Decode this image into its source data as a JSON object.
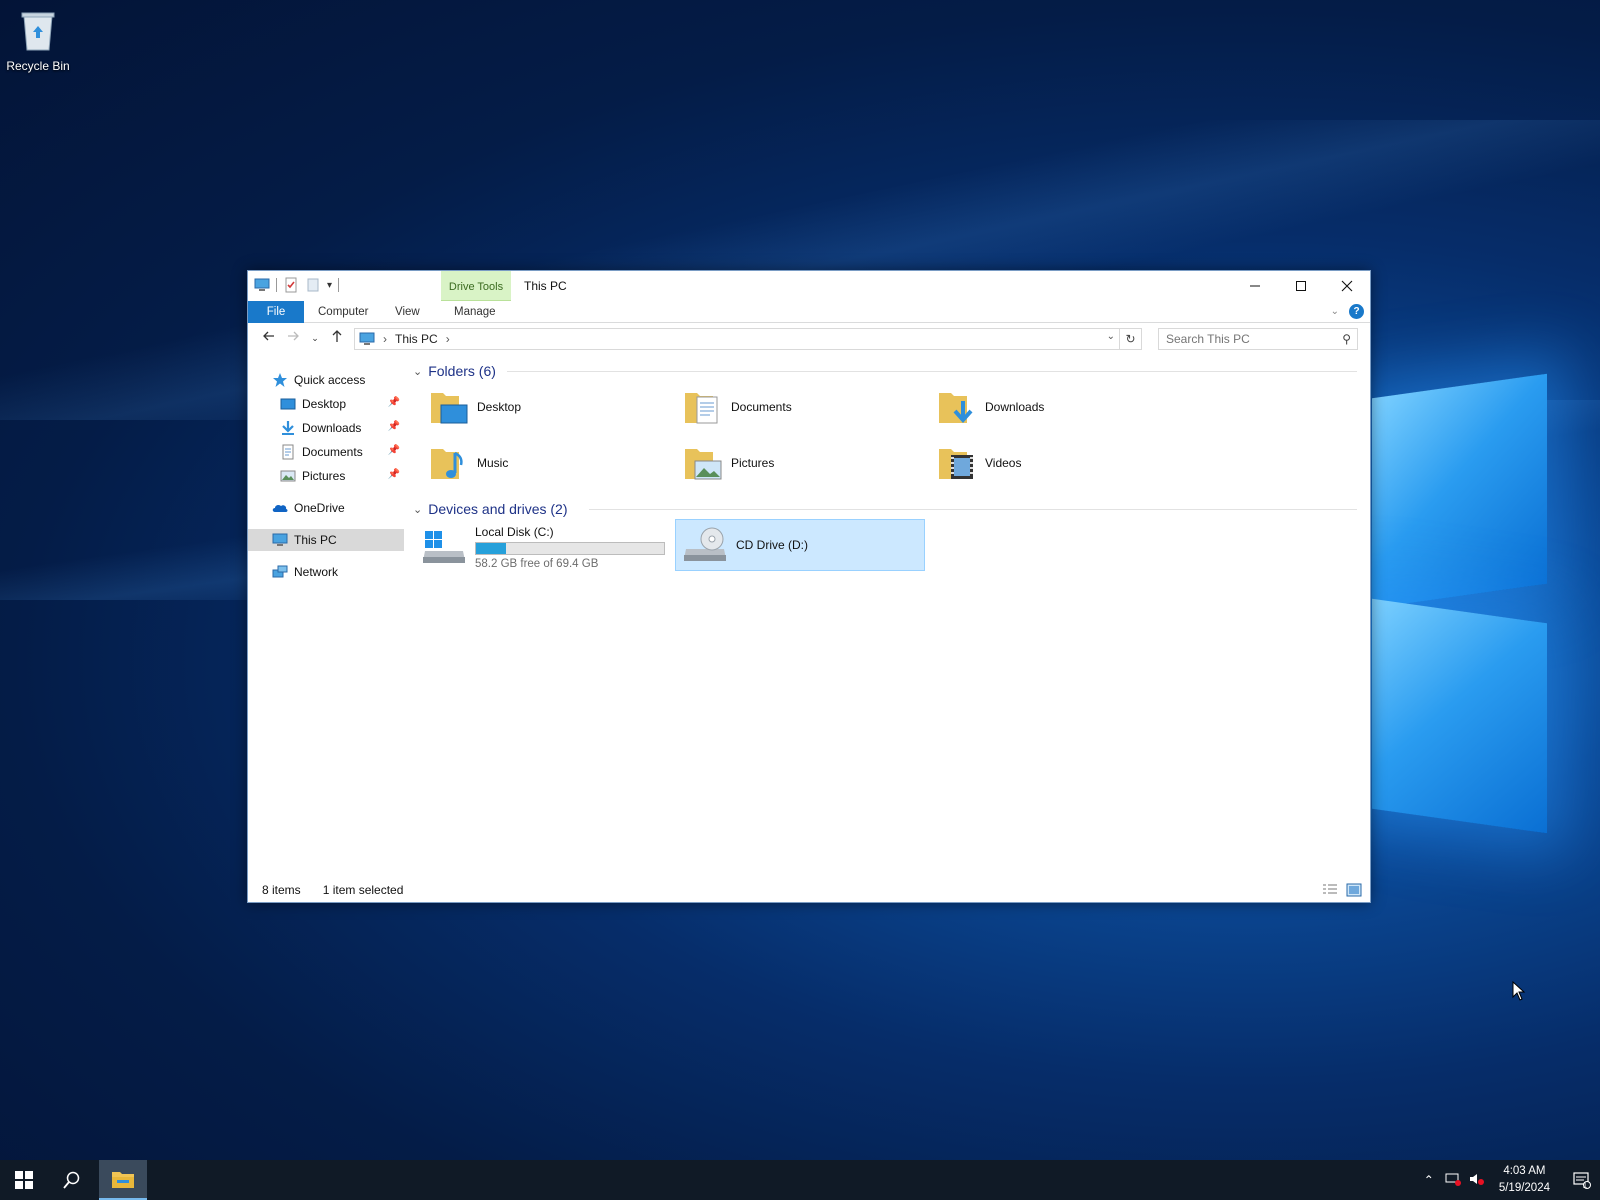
{
  "desktop": {
    "recycle_bin_label": "Recycle Bin"
  },
  "window": {
    "title": "This PC",
    "context_tab_group": "Drive Tools",
    "ribbon_tabs": {
      "file": "File",
      "computer": "Computer",
      "view": "View",
      "manage": "Manage"
    },
    "help_glyph": "?",
    "address": {
      "crumb": "This PC"
    },
    "search": {
      "placeholder": "Search This PC"
    },
    "nav": {
      "quick_access": "Quick access",
      "desktop": "Desktop",
      "downloads": "Downloads",
      "documents": "Documents",
      "pictures": "Pictures",
      "onedrive": "OneDrive",
      "this_pc": "This PC",
      "network": "Network"
    },
    "folders_header": "Folders (6)",
    "folders": {
      "desktop": "Desktop",
      "documents": "Documents",
      "downloads": "Downloads",
      "music": "Music",
      "pictures": "Pictures",
      "videos": "Videos"
    },
    "devices_header": "Devices and drives (2)",
    "drives": {
      "c_name": "Local Disk (C:)",
      "c_space": "58.2 GB free of 69.4 GB",
      "c_used_fraction": 0.161,
      "d_name": "CD Drive (D:)"
    },
    "status": {
      "items": "8 items",
      "selected": "1 item selected"
    }
  },
  "taskbar": {
    "time": "4:03 AM",
    "date": "5/19/2024",
    "notification_count": "1"
  },
  "colors": {
    "accent": "#1979ca",
    "selection": "#cce8ff",
    "drive_tools": "#d9f3c6",
    "taskbar": "#101a26"
  }
}
